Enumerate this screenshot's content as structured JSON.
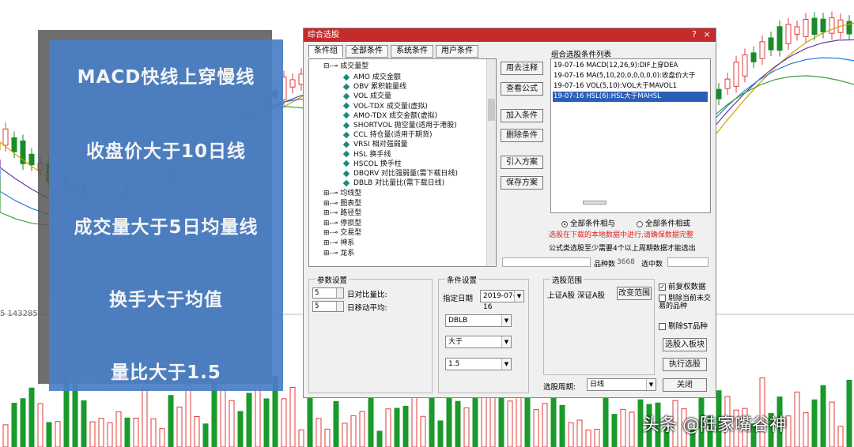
{
  "overlay": {
    "lines": [
      "MACD快线上穿慢线",
      "收盘价大于10日线",
      "成交量大于5日均量线",
      "换手大于均值",
      "量比大于1.5"
    ]
  },
  "background": {
    "left_text": "5  143285   ",
    "watermark": "头条 @陆家嘴谷神"
  },
  "dialog": {
    "title": "综合选股",
    "minimize_icon": "?",
    "close_icon": "×",
    "tabs": [
      "条件组",
      "全部条件",
      "系统条件",
      "用户条件"
    ],
    "tree": {
      "group_open": "成交量型",
      "items": [
        "AMO 成交金额",
        "OBV 累积能量线",
        "VOL 成交量",
        "VOL-TDX 成交量(虚拟)",
        "AMO-TDX 成交金额(虚拟)",
        "SHORTVOL 抛空量(适用于港股)",
        "CCL 持仓量(适用于期货)",
        "VRSI 相对强弱量",
        "HSL 换手线",
        "HSCOL 换手柱",
        "DBQRV 对比强弱量(需下载日线)",
        "DBLB 对比量比(需下载日线)"
      ],
      "groups_closed": [
        "均线型",
        "图表型",
        "路径型",
        "停损型",
        "交易型",
        "神系",
        "龙系"
      ]
    },
    "mid_buttons": [
      "用去注释",
      "查看公式",
      "加入条件",
      "删除条件",
      "引入方案",
      "保存方案"
    ],
    "list_title": "组合选股条件列表",
    "conditions": [
      "19-07-16 MACD(12,26,9):DIF上穿DEA",
      "19-07-16 MA(5,10,20,0,0,0,0,0):收盘价大于",
      "19-07-16 VOL(5,10):VOL大于MAVOL1",
      "19-07-16 HSL(6):HSL大于MAHSL"
    ],
    "radio_and": "全部条件相与",
    "radio_or": "全部条件相或",
    "warning": "选股在下载的本地数据中进行,请确保数据完整",
    "note": "公式类选股至少需要4个以上周期数据才能选出",
    "count_label": "品种数",
    "count_value": "3668",
    "selected_label": "选中数",
    "params": {
      "title": "参数设置",
      "row1_value": "5",
      "row1_label": "日对比量比:",
      "row2_value": "5",
      "row2_label": "日移动平均:"
    },
    "cond": {
      "title": "条件设置",
      "date_label": "指定日期",
      "date_value": "2019-07-16",
      "indicator": "DBLB",
      "operator": "大于",
      "value": "1.5"
    },
    "range": {
      "title": "选股范围",
      "items": "上证A股  深证A股",
      "change_button": "改变范围"
    },
    "options": {
      "fq": "前复权数据",
      "exclude_stop": "剔除当前未交易的品种",
      "exclude_st": "剔除ST品种"
    },
    "bottom": {
      "period_label": "选股周期:",
      "period_value": "日线",
      "add_board": "选股入板块",
      "execute": "执行选股",
      "close": "关闭"
    }
  }
}
